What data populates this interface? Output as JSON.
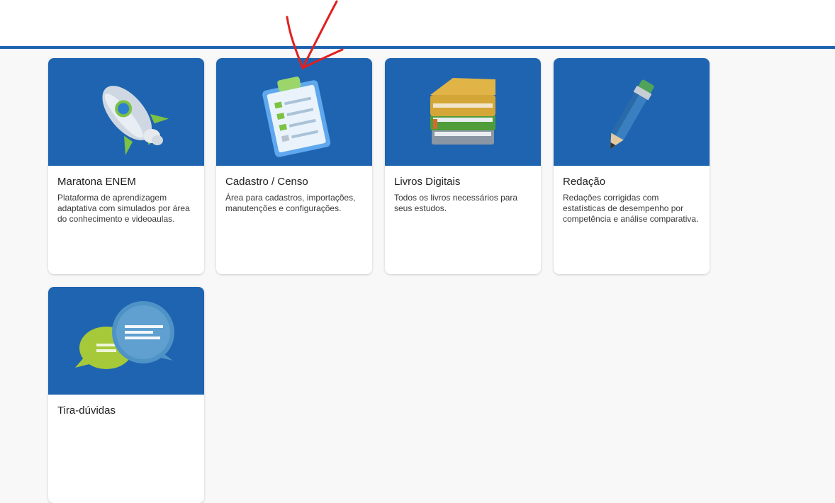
{
  "colors": {
    "brand": "#1f64b0",
    "background": "#f8f8f8",
    "annotation": "#e02020"
  },
  "cards": [
    {
      "icon": "rocket-icon",
      "title": "Maratona ENEM",
      "description": "Plataforma de aprendizagem adaptativa com simulados por área do conhecimento e videoaulas."
    },
    {
      "icon": "clipboard-checklist-icon",
      "title": "Cadastro / Censo",
      "description": "Área para cadastros, importações, manutenções e configurações."
    },
    {
      "icon": "books-stack-icon",
      "title": "Livros Digitais",
      "description": "Todos os livros necessários para seus estudos."
    },
    {
      "icon": "pencil-icon",
      "title": "Redação",
      "description": "Redações corrigidas com estatísticas de desempenho por competência e análise comparativa."
    },
    {
      "icon": "chat-bubbles-icon",
      "title": "Tira-dúvidas",
      "description": ""
    }
  ]
}
